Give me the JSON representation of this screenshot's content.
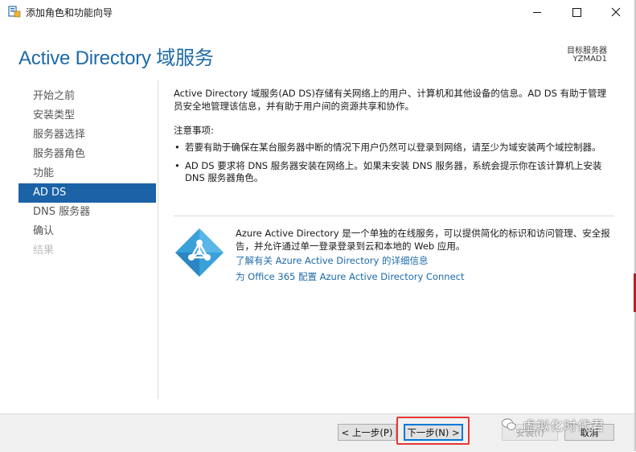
{
  "window": {
    "title": "添加角色和功能向导",
    "title_color": "#1a1a1a"
  },
  "header": {
    "page_title": "Active Directory 域服务",
    "target_label": "目标服务器",
    "target_name": "YZMAD1",
    "accent": "#1d6aa8"
  },
  "sidebar": {
    "items": [
      {
        "label": "开始之前",
        "state": "normal"
      },
      {
        "label": "安装类型",
        "state": "normal"
      },
      {
        "label": "服务器选择",
        "state": "normal"
      },
      {
        "label": "服务器角色",
        "state": "normal"
      },
      {
        "label": "功能",
        "state": "normal"
      },
      {
        "label": "AD DS",
        "state": "active"
      },
      {
        "label": "DNS 服务器",
        "state": "normal"
      },
      {
        "label": "确认",
        "state": "normal"
      },
      {
        "label": "结果",
        "state": "disabled"
      }
    ],
    "active_color": "#1b62a6"
  },
  "main": {
    "intro": "Active Directory 域服务(AD DS)存储有关网络上的用户、计算机和其他设备的信息。AD DS 有助于管理员安全地管理该信息，并有助于用户间的资源共享和协作。",
    "notes_heading": "注意事项:",
    "notes": [
      "若要有助于确保在某台服务器中断的情况下用户仍然可以登录到网络，请至少为域安装两个域控制器。",
      "AD DS 要求将 DNS 服务器安装在网络上。如果未安装 DNS 服务器，系统会提示你在该计算机上安装 DNS 服务器角色。"
    ],
    "azure": {
      "icon": "azure-ad-icon",
      "description": "Azure Active Directory 是一个单独的在线服务，可以提供简化的标识和访问管理、安全报告，并允许通过单一登录登录到云和本地的 Web 应用。",
      "link_learn_more": "了解有关 Azure Active Directory 的详细信息",
      "link_connect": "为 Office 365 配置 Azure Active Directory Connect"
    }
  },
  "footer": {
    "prev": "< 上一步(P)",
    "next": "下一步(N) >",
    "install": "安装(I)",
    "cancel": "取消"
  },
  "watermark": {
    "text": "虚拟化时代君"
  }
}
